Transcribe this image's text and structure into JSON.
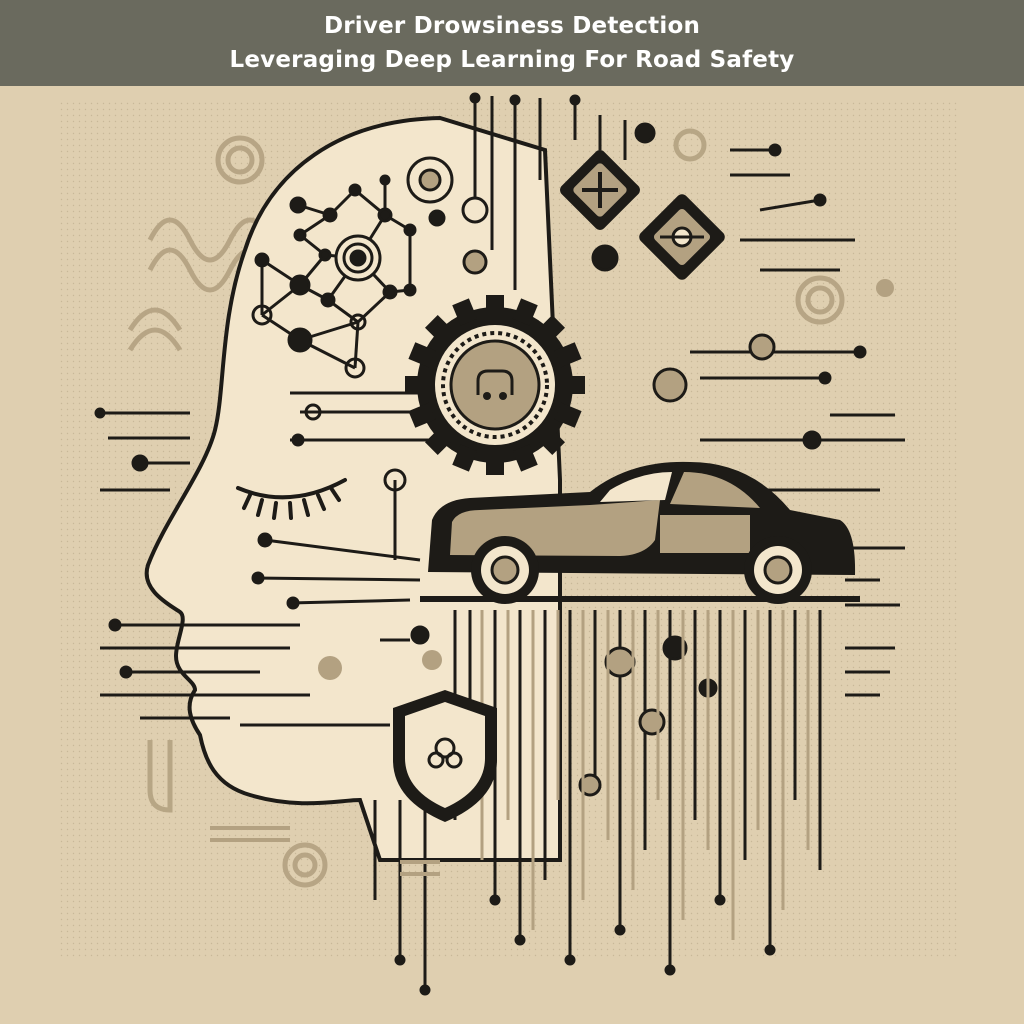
{
  "banner": {
    "title": "Driver Drowsiness Detection",
    "subtitle": "Leveraging Deep Learning For Road Safety"
  },
  "illustration": {
    "icons": [
      "head-profile-icon",
      "closed-eye-icon",
      "gear-icon",
      "car-icon",
      "shield-icon",
      "neural-network-icon",
      "road-sign-icon"
    ],
    "colors": {
      "background": "#dfcfb0",
      "head_fill": "#f3e6cc",
      "ink": "#1d1b17",
      "tan": "#b3a181",
      "banner": "#6a6a5e"
    }
  }
}
